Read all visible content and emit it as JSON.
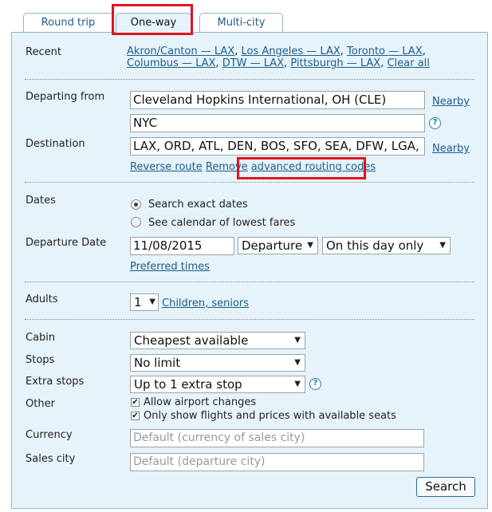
{
  "tabs": [
    {
      "label": "Round trip"
    },
    {
      "label": "One-way"
    },
    {
      "label": "Multi-city"
    }
  ],
  "recent": {
    "label": "Recent",
    "items": [
      "Akron/Canton — LAX",
      "Los Angeles — LAX",
      "Toronto — LAX",
      "Columbus — LAX",
      "DTW — LAX",
      "Pittsburgh — LAX"
    ],
    "clear_label": "Clear all"
  },
  "departing": {
    "label": "Departing from",
    "value": "Cleveland Hopkins International, OH (CLE)",
    "nearby_label": "Nearby"
  },
  "destination": {
    "label": "Destination",
    "value_primary": "NYC",
    "value_extra": "LAX, ORD, ATL, DEN, BOS, SFO, SEA, DFW, LGA,",
    "nearby_label": "Nearby",
    "reverse_route_label": "Reverse route",
    "remove_label": "Remove",
    "advanced_label": "advanced routing codes",
    "help_icon": "?"
  },
  "dates": {
    "label": "Dates",
    "exact_label": "Search exact dates",
    "calendar_label": "See calendar of lowest fares",
    "selected": "exact"
  },
  "departure_date": {
    "label": "Departure Date",
    "value": "11/08/2015",
    "type_value": "Departure",
    "flex_value": "On this day only",
    "preferred_times_label": "Preferred times"
  },
  "adults": {
    "label": "Adults",
    "value": "1",
    "children_label": "Children, seniors"
  },
  "cabin": {
    "label": "Cabin",
    "value": "Cheapest available"
  },
  "stops": {
    "label": "Stops",
    "value": "No limit"
  },
  "extra_stops": {
    "label": "Extra stops",
    "value": "Up to 1 extra stop",
    "help_icon": "?"
  },
  "other": {
    "label": "Other",
    "allow_airport_changes": "Allow airport changes",
    "only_available_seats": "Only show flights and prices with available seats"
  },
  "currency": {
    "label": "Currency",
    "placeholder": "Default (currency of sales city)"
  },
  "sales_city": {
    "label": "Sales city",
    "placeholder": "Default (departure city)"
  },
  "search_button": "Search",
  "colors": {
    "panel_bg": "#e6f3fb",
    "link": "#1f5c8a",
    "highlight": "#e0141e",
    "border": "#8fb3cc"
  }
}
